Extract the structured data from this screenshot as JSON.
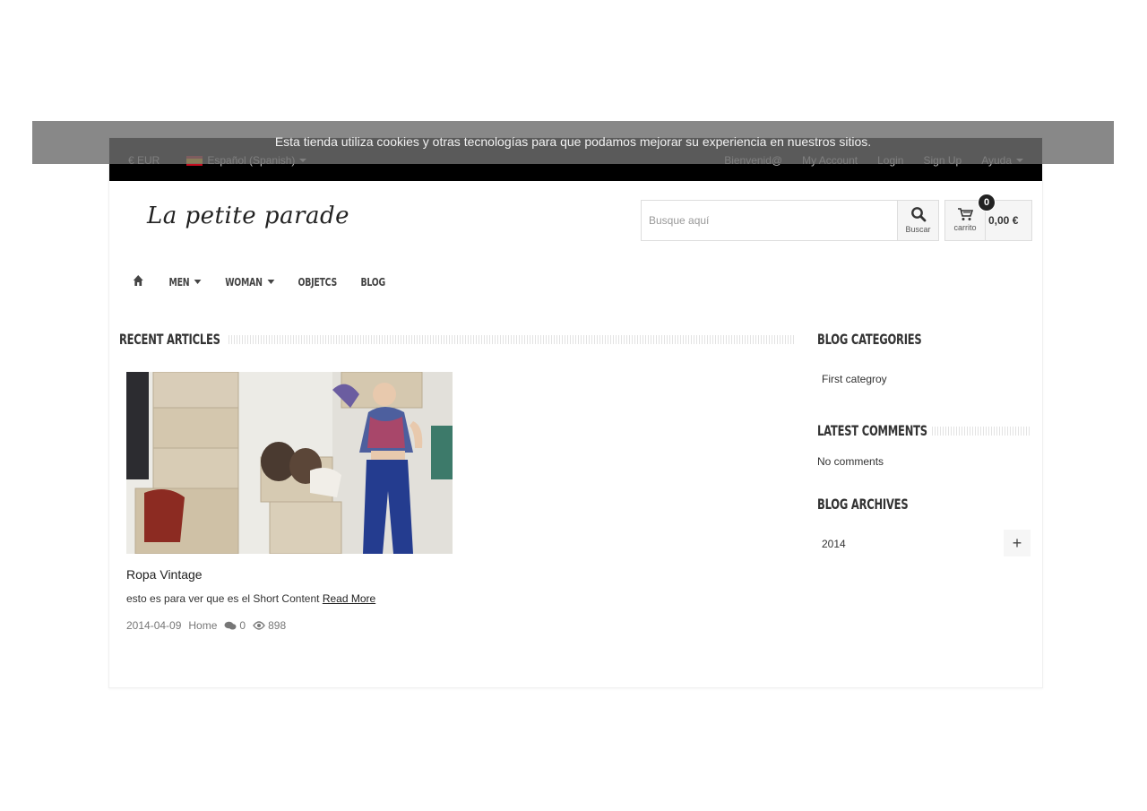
{
  "topbar": {
    "currency": "€ EUR",
    "language": "Español (Spanish)",
    "links": [
      "Bienvenid@",
      "My Account",
      "Login",
      "Sign Up",
      "Ayuda"
    ]
  },
  "cookie_notice": "Esta tienda utiliza cookies y otras tecnologías para que podamos mejorar su experiencia en nuestros sitios.",
  "logo_text": "La petite parade",
  "search": {
    "placeholder": "Busque aquí",
    "button_label": "Buscar"
  },
  "cart": {
    "label": "carrito",
    "count": "0",
    "total": "0,00 €"
  },
  "menu": {
    "items": [
      "MEN",
      "WOMAN",
      "OBJETCS",
      "BLOG"
    ]
  },
  "main": {
    "title": "RECENT ARTICLES",
    "post": {
      "title": "Ropa Vintage",
      "short": "esto es para ver que es el Short Content",
      "read_more": "Read More",
      "date": "2014-04-09",
      "category": "Home",
      "comments": "0",
      "views": "898"
    }
  },
  "sidebar": {
    "categories_title": "BLOG CATEGORIES",
    "categories": [
      "First categroy"
    ],
    "comments_title": "LATEST COMMENTS",
    "comments_empty": "No comments",
    "archives_title": "BLOG ARCHIVES",
    "archives": [
      "2014"
    ],
    "expand_symbol": "+"
  },
  "colors": {
    "topbar": "#000000",
    "accent": "#333333",
    "overlay": "#6e6e6e"
  }
}
